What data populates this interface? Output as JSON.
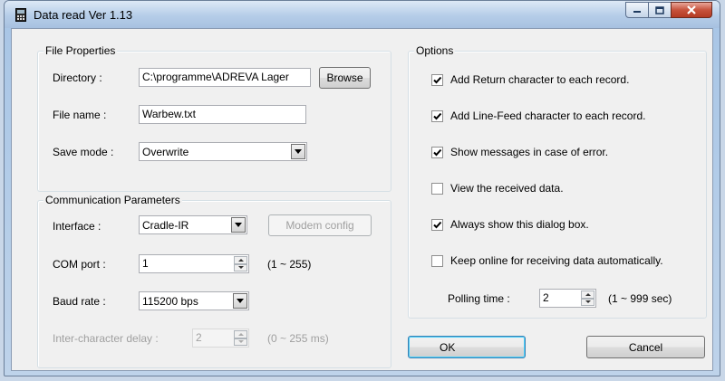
{
  "window": {
    "title": "Data read  Ver 1.13"
  },
  "file_properties": {
    "group_title": "File Properties",
    "directory_label": "Directory :",
    "directory_value": "C:\\programme\\ADREVA Lager",
    "browse_label": "Browse",
    "filename_label": "File name :",
    "filename_value": "Warbew.txt",
    "save_mode_label": "Save mode :",
    "save_mode_value": "Overwrite"
  },
  "communication": {
    "group_title": "Communication Parameters",
    "interface_label": "Interface :",
    "interface_value": "Cradle-IR",
    "modem_config_label": "Modem config",
    "com_port_label": "COM port :",
    "com_port_value": "1",
    "com_port_range": "(1 ~ 255)",
    "baud_rate_label": "Baud rate :",
    "baud_rate_value": "115200 bps",
    "delay_label": "Inter-character delay :",
    "delay_value": "2",
    "delay_range": "(0 ~ 255 ms)"
  },
  "options": {
    "group_title": "Options",
    "items": [
      {
        "label": "Add Return character to each record.",
        "checked": true
      },
      {
        "label": "Add Line-Feed character to each record.",
        "checked": true
      },
      {
        "label": "Show messages in case of error.",
        "checked": true
      },
      {
        "label": "View the received data.",
        "checked": false
      },
      {
        "label": "Always show this dialog box.",
        "checked": true
      },
      {
        "label": "Keep online for receiving data automatically.",
        "checked": false
      }
    ],
    "polling_label": "Polling time :",
    "polling_value": "2",
    "polling_range": "(1 ~ 999 sec)"
  },
  "buttons": {
    "ok": "OK",
    "cancel": "Cancel"
  }
}
